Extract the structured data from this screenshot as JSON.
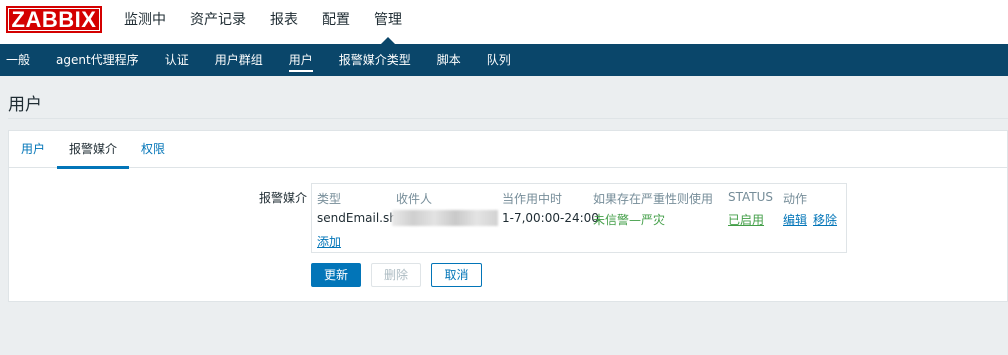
{
  "brand": {
    "logo_text": "ZABBIX",
    "color": "#d40000"
  },
  "top_menu": [
    {
      "label": "监测中",
      "active": false
    },
    {
      "label": "资产记录",
      "active": false
    },
    {
      "label": "报表",
      "active": false
    },
    {
      "label": "配置",
      "active": false
    },
    {
      "label": "管理",
      "active": true
    }
  ],
  "sub_menu": [
    {
      "label": "一般",
      "active": false
    },
    {
      "label": "agent代理程序",
      "active": false
    },
    {
      "label": "认证",
      "active": false
    },
    {
      "label": "用户群组",
      "active": false
    },
    {
      "label": "用户",
      "active": true
    },
    {
      "label": "报警媒介类型",
      "active": false
    },
    {
      "label": "脚本",
      "active": false
    },
    {
      "label": "队列",
      "active": false
    }
  ],
  "page": {
    "title": "用户"
  },
  "tabs": [
    {
      "label": "用户",
      "active": false
    },
    {
      "label": "报警媒介",
      "active": true
    },
    {
      "label": "权限",
      "active": false
    }
  ],
  "media": {
    "label": "报警媒介",
    "headers": {
      "type": "类型",
      "recipient": "收件人",
      "when_active": "当作用中时",
      "use_if_severity": "如果存在严重性则使用",
      "status": "STATUS",
      "actions": "动作"
    },
    "row": {
      "type": "sendEmail.sh",
      "recipient": "",
      "when_active": "1-7,00:00-24:00",
      "severity": "未信警—严灾",
      "status": "已启用",
      "edit": "编辑",
      "remove": "移除"
    },
    "add_link": "添加"
  },
  "buttons": {
    "update": "更新",
    "delete": "删除",
    "cancel": "取消"
  },
  "colors": {
    "nav_dark": "#0a466a",
    "link": "#0275b8",
    "enabled_green": "#429e47"
  }
}
